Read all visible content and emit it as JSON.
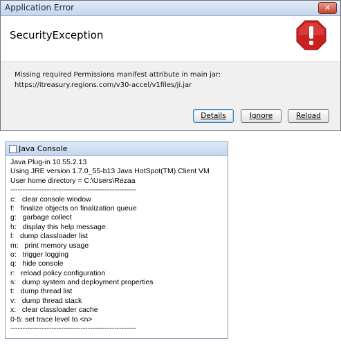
{
  "error_dialog": {
    "title": "Application Error",
    "close_symbol": "✕",
    "heading": "SecurityException",
    "icon": "error-stop-icon",
    "icon_color": "#cc1f1f",
    "message_line1": "Missing required Permissions manifest attribute in main jar:",
    "message_line2": "https://itreasury.regions.com/v30-accel/v1files/ji.jar",
    "buttons": {
      "details": "Details",
      "ignore": "Ignore",
      "reload": "Reload"
    }
  },
  "java_console": {
    "title": "Java Console",
    "lines": [
      "Java Plug-in 10.55.2.13",
      "Using JRE version 1.7.0_55-b13 Java HotSpot(TM) Client VM",
      "User home directory = C:\\Users\\Rezaa",
      "----------------------------------------------------",
      "c:   clear console window",
      "f:   finalize objects on finalization queue",
      "g:   garbage collect",
      "h:   display this help message",
      "l:   dump classloader list",
      "m:   print memory usage",
      "o:   trigger logging",
      "q:   hide console",
      "r:   reload policy configuration",
      "s:   dump system and deployment properties",
      "t:   dump thread list",
      "v:   dump thread stack",
      "x:   clear classloader cache",
      "0-5: set trace level to <n>",
      "----------------------------------------------------"
    ]
  }
}
